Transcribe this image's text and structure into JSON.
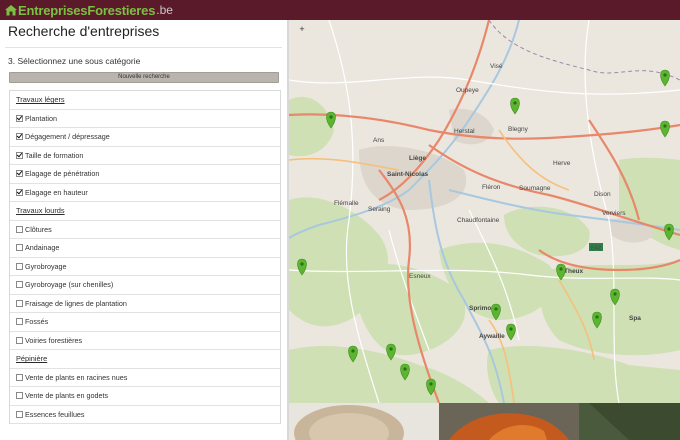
{
  "brand": {
    "name": "EntreprisesForestieres",
    "tld": ".be",
    "bar_color": "#5a1a2a",
    "accent": "#7cc043"
  },
  "page": {
    "title": "Recherche d'entreprises",
    "step": "3. Sélectionnez une sous catégorie",
    "new_search_label": "Nouvelle recherche"
  },
  "categories": [
    {
      "heading": "Travaux légers",
      "items": [
        {
          "label": "Plantation",
          "checked": true
        },
        {
          "label": "Dégagement / dépressage",
          "checked": true
        },
        {
          "label": "Taille de formation",
          "checked": true
        },
        {
          "label": "Elagage de pénétration",
          "checked": true
        },
        {
          "label": "Elagage en hauteur",
          "checked": true
        }
      ]
    },
    {
      "heading": "Travaux lourds",
      "items": [
        {
          "label": "Clôtures",
          "checked": false
        },
        {
          "label": "Andainage",
          "checked": false
        },
        {
          "label": "Gyrobroyage",
          "checked": false
        },
        {
          "label": "Gyrobroyage (sur chenilles)",
          "checked": false
        },
        {
          "label": "Fraisage de lignes de plantation",
          "checked": false
        },
        {
          "label": "Fossés",
          "checked": false
        },
        {
          "label": "Voiries forestières",
          "checked": false
        }
      ]
    },
    {
      "heading": "Pépinière",
      "items": [
        {
          "label": "Vente de plants en racines nues",
          "checked": false
        },
        {
          "label": "Vente de plants en godets",
          "checked": false
        },
        {
          "label": "Essences feuillues",
          "checked": false
        }
      ]
    }
  ],
  "map": {
    "zoom_in_label": "+",
    "places": {
      "vise": "Visé",
      "oupeye": "Oupeye",
      "blegny": "Blegny",
      "ans": "Ans",
      "herstal": "Herstal",
      "liege": "Liège",
      "herve": "Herve",
      "saint_nicolas": "Saint-Nicolas",
      "fleron": "Fléron",
      "soumagne": "Soumagne",
      "dison": "Dison",
      "flemalle": "Flémalle",
      "seraing": "Seraing",
      "chaudfontaine": "Chaudfontaine",
      "verviers": "Verviers",
      "esneux": "Esneux",
      "theux": "Theux",
      "sprimont": "Sprimont",
      "spa": "Spa",
      "aywaille": "Aywaille",
      "route_e42": "E42"
    },
    "marker_color": "#5cb531"
  }
}
